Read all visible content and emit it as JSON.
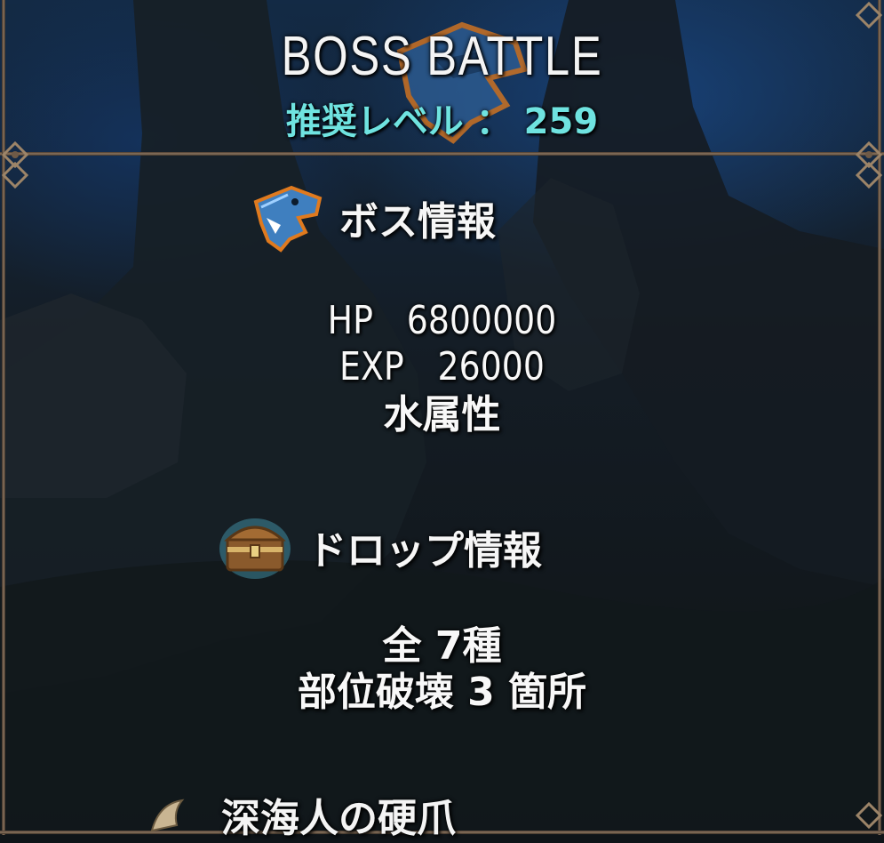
{
  "header": {
    "title": "BOSS BATTLE",
    "recommended_level": "推奨レベル ： 259"
  },
  "boss_info": {
    "heading": "ボス情報",
    "icon": "shark-head-icon",
    "hp": "HP　6800000",
    "exp": "EXP　26000",
    "attribute": "水属性"
  },
  "drop_info": {
    "heading": "ドロップ情報",
    "icon": "treasure-chest-icon",
    "total": "全 7種",
    "part_break": "部位破壊 3 箇所",
    "items": [
      {
        "icon": "claw-icon",
        "name": "深海人の硬爪"
      }
    ]
  },
  "colors": {
    "level_text": "#6fe3e0",
    "frame": "#8c7560",
    "icon_blue": "#3f7fbf",
    "icon_glow": "#e07a1e"
  }
}
